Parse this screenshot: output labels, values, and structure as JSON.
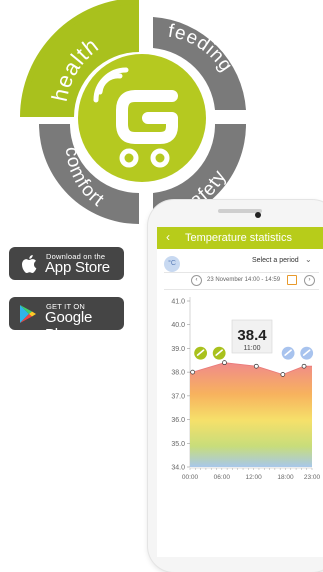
{
  "ring": {
    "segments": [
      "health",
      "feeding",
      "safety",
      "comfort"
    ],
    "colors": {
      "active": "#a9c11d",
      "inactive": "#7a7a7a",
      "center": "#b5c920"
    }
  },
  "stores": {
    "apple": {
      "small": "Download on the",
      "big": "App Store"
    },
    "google": {
      "small": "GET IT ON",
      "big": "Google Play"
    }
  },
  "app": {
    "title": "Temperature statistics",
    "back": "‹",
    "unit": "°C",
    "period_label": "Select a period",
    "range": "23 November 14:00 - 14:59",
    "tooltip": {
      "value": "38.4",
      "time": "11:00"
    }
  },
  "chart_data": {
    "type": "area",
    "y_ticks": [
      "41.0",
      "40.0",
      "39.0",
      "38.0",
      "37.0",
      "36.0",
      "35.0",
      "34.0"
    ],
    "x_ticks": [
      "00:00",
      "06:00",
      "12:00",
      "18:00",
      "23:00"
    ],
    "ylim": [
      34.0,
      41.0
    ],
    "xlim": [
      0,
      23
    ],
    "points": [
      {
        "x": 0.5,
        "y": 38.0
      },
      {
        "x": 6.5,
        "y": 38.4
      },
      {
        "x": 12.5,
        "y": 38.25
      },
      {
        "x": 17.5,
        "y": 37.9
      },
      {
        "x": 21.5,
        "y": 38.25
      }
    ],
    "markers": [
      {
        "x": 2.0,
        "kind": "health",
        "color": "#a9c11d"
      },
      {
        "x": 5.5,
        "kind": "health",
        "color": "#a9c11d"
      },
      {
        "x": 18.5,
        "kind": "info",
        "color": "#a8c3ee"
      },
      {
        "x": 22.0,
        "kind": "info",
        "color": "#a8c3ee"
      }
    ]
  }
}
